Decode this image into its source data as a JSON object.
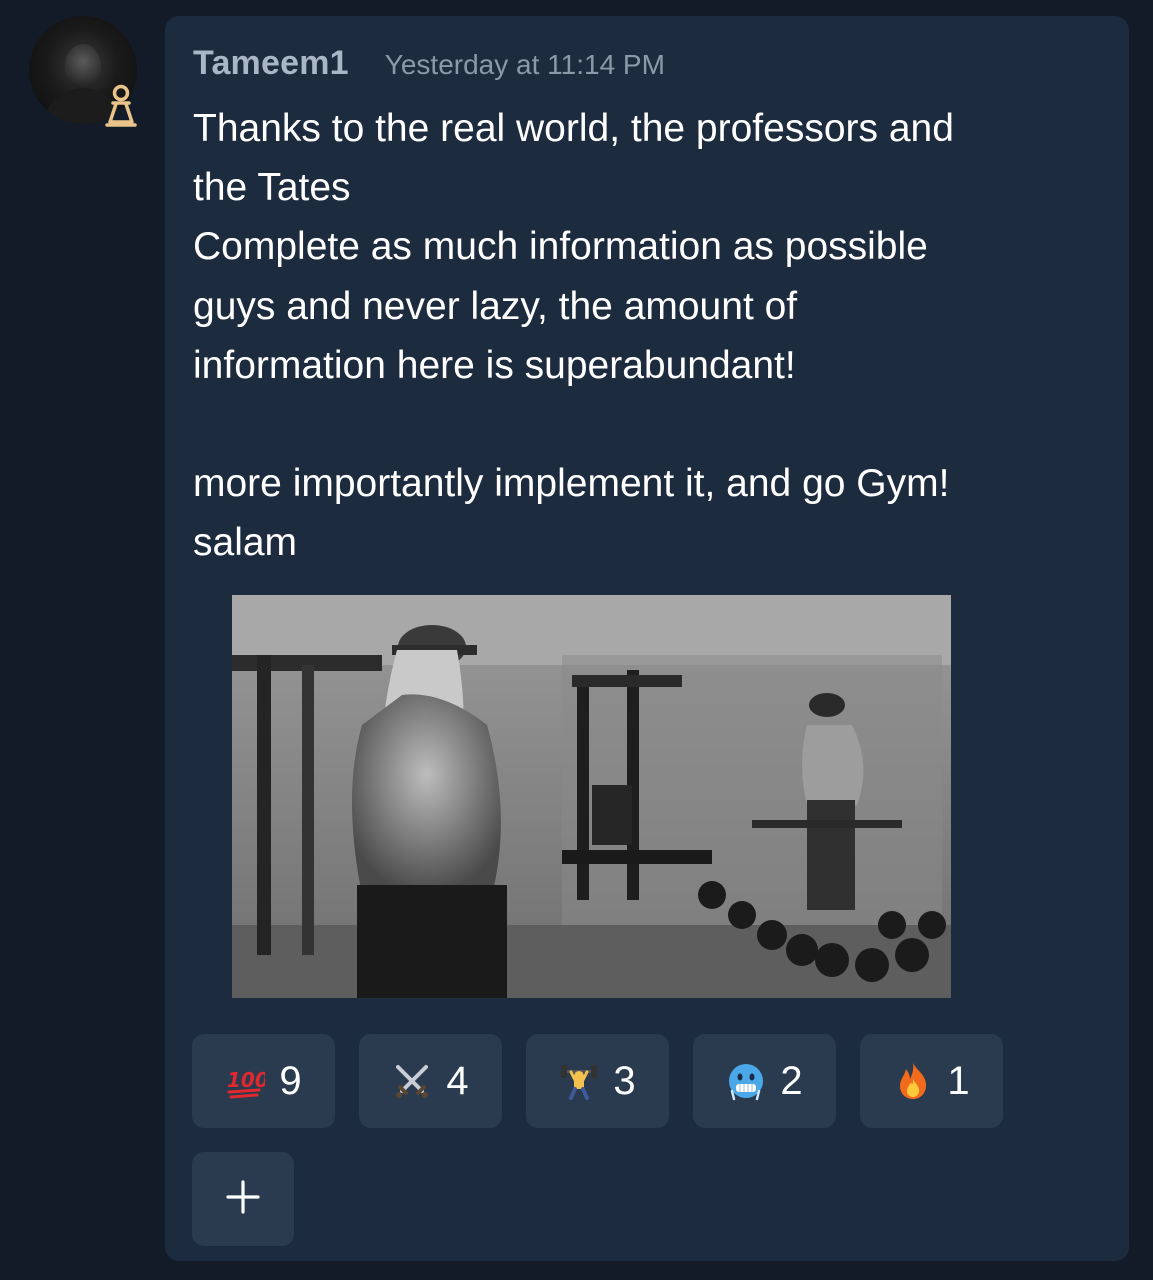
{
  "message": {
    "author": "Tameem1",
    "timestamp": "Yesterday at 11:14 PM",
    "body": "Thanks to the real world, the professors and\nthe Tates\nComplete as much information as possible\nguys and never lazy, the amount of\ninformation here is superabundant!\n\nmore importantly implement it, and go Gym!\nsalam",
    "role_badge_icon": "pawn-icon",
    "role_badge_color": "#e8c48a"
  },
  "reactions": [
    {
      "emoji": "hundred-points-icon",
      "count": "9"
    },
    {
      "emoji": "crossed-swords-icon",
      "count": "4"
    },
    {
      "emoji": "weight-lifter-icon",
      "count": "3"
    },
    {
      "emoji": "cold-face-icon",
      "count": "2"
    },
    {
      "emoji": "fire-icon",
      "count": "1"
    }
  ],
  "add_reaction": {
    "icon": "plus-icon"
  },
  "colors": {
    "background": "#121b27",
    "card": "#1d2b3e",
    "reaction_bg": "#2a3a4f",
    "username": "#a8b6c6",
    "timestamp": "#8b98a8"
  }
}
